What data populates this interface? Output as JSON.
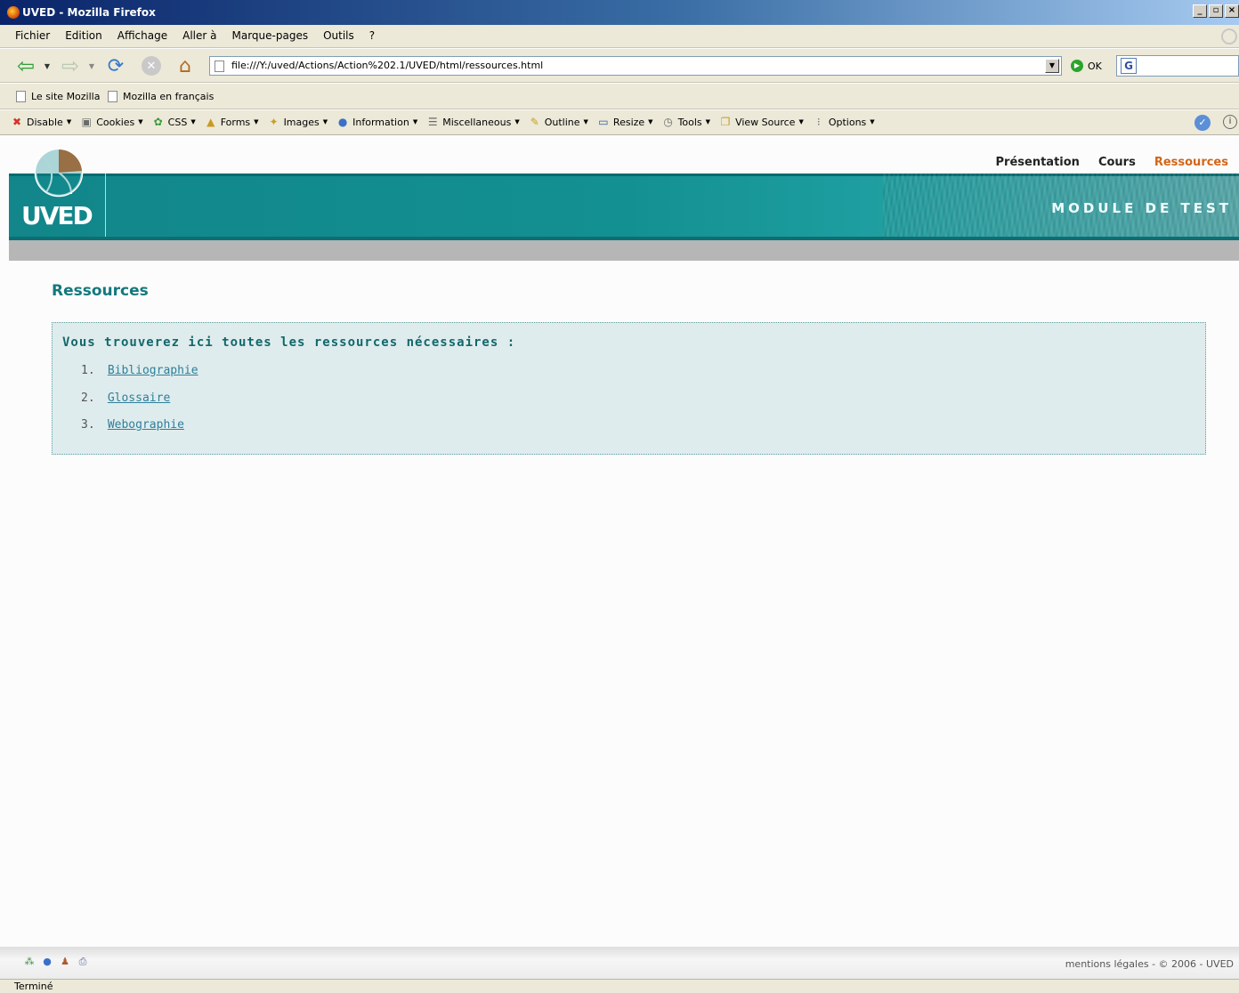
{
  "window": {
    "title": "UVED - Mozilla Firefox",
    "minimize": "_",
    "maximize": "×"
  },
  "menu": {
    "items": [
      "Fichier",
      "Edition",
      "Affichage",
      "Aller à",
      "Marque-pages",
      "Outils",
      "?"
    ]
  },
  "navbar": {
    "url": "file:///Y:/uved/Actions/Action%202.1/UVED/html/ressources.html",
    "go_label": "OK"
  },
  "bookmarks": {
    "items": [
      "Le site Mozilla",
      "Mozilla en français"
    ]
  },
  "devbar": {
    "items": [
      "Disable",
      "Cookies",
      "CSS",
      "Forms",
      "Images",
      "Information",
      "Miscellaneous",
      "Outline",
      "Resize",
      "Tools",
      "View Source",
      "Options"
    ]
  },
  "site": {
    "logo_text": "UVED",
    "module_title": "MODULE DE TEST",
    "nav": [
      "Présentation",
      "Cours",
      "Ressources"
    ],
    "page_title": "Ressources",
    "intro": "Vous trouverez ici toutes les ressources nécessaires :",
    "resources": [
      {
        "num": "1.",
        "label": "Bibliographie"
      },
      {
        "num": "2.",
        "label": "Glossaire"
      },
      {
        "num": "3.",
        "label": "Webographie"
      }
    ],
    "footer_legal": "mentions légales - © 2006 - UVED"
  },
  "status": {
    "text": "Terminé"
  },
  "colors": {
    "accent": "#13797d",
    "active_nav": "#d2661a",
    "panel_bg": "#dfeced",
    "banner": "#12868a"
  }
}
